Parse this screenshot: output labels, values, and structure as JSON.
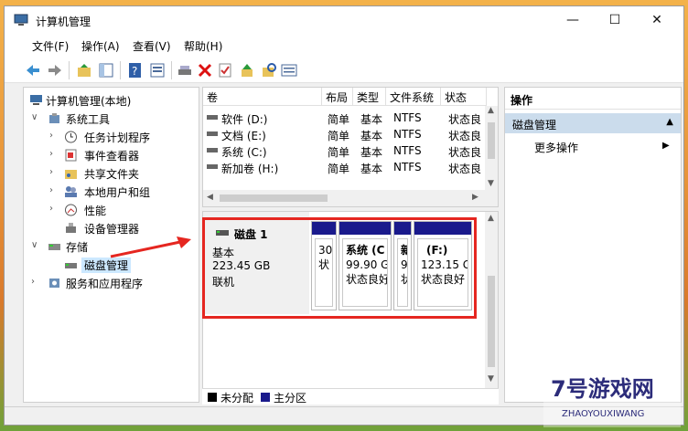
{
  "window": {
    "title": "计算机管理",
    "minimize_label": "—",
    "maximize_label": "☐",
    "close_label": "✕"
  },
  "menu": [
    "文件(F)",
    "操作(A)",
    "查看(V)",
    "帮助(H)"
  ],
  "toolbar": [
    "back",
    "forward",
    "up-folder",
    "show-hide-tree",
    "help",
    "properties",
    "connect",
    "delete",
    "check",
    "export",
    "search",
    "list"
  ],
  "tree": {
    "root": "计算机管理(本地)",
    "system_tools": "系统工具",
    "task_scheduler": "任务计划程序",
    "event_viewer": "事件查看器",
    "shared_folders": "共享文件夹",
    "local_users": "本地用户和组",
    "performance": "性能",
    "device_manager": "设备管理器",
    "storage": "存储",
    "disk_management": "磁盘管理",
    "services": "服务和应用程序"
  },
  "volumes": {
    "columns": [
      "卷",
      "布局",
      "类型",
      "文件系统",
      "状态"
    ],
    "rows": [
      {
        "name": "软件 (D:)",
        "layout": "简单",
        "type": "基本",
        "fs": "NTFS",
        "status": "状态良"
      },
      {
        "name": "文档 (E:)",
        "layout": "简单",
        "type": "基本",
        "fs": "NTFS",
        "status": "状态良"
      },
      {
        "name": "系统 (C:)",
        "layout": "简单",
        "type": "基本",
        "fs": "NTFS",
        "status": "状态良"
      },
      {
        "name": "新加卷 (H:)",
        "layout": "简单",
        "type": "基本",
        "fs": "NTFS",
        "status": "状态良"
      }
    ]
  },
  "disk": {
    "name": "磁盘 1",
    "kind": "基本",
    "size": "223.45 GB",
    "state": "联机",
    "partitions": [
      {
        "line1": "",
        "line2": "30",
        "line3": "状"
      },
      {
        "line1": "系统 (C",
        "line2": "99.90 G",
        "line3": "状态良好"
      },
      {
        "line1": "新",
        "line2": "9",
        "line3": "状"
      },
      {
        "line1": "(F:)",
        "line2": "123.15 G",
        "line3": "状态良好"
      }
    ]
  },
  "legend": {
    "unallocated": "未分配",
    "primary": "主分区",
    "unallocated_color": "#000000",
    "primary_color": "#1a1a8c"
  },
  "actions": {
    "header": "操作",
    "section": "磁盘管理",
    "more": "更多操作"
  },
  "colors": {
    "selection": "#cce8ff",
    "partition_bar": "#1a1a8c",
    "highlight": "#e52620"
  },
  "watermark": {
    "brand": "7号游戏网",
    "url": "ZHAOYOUXIWANG"
  }
}
